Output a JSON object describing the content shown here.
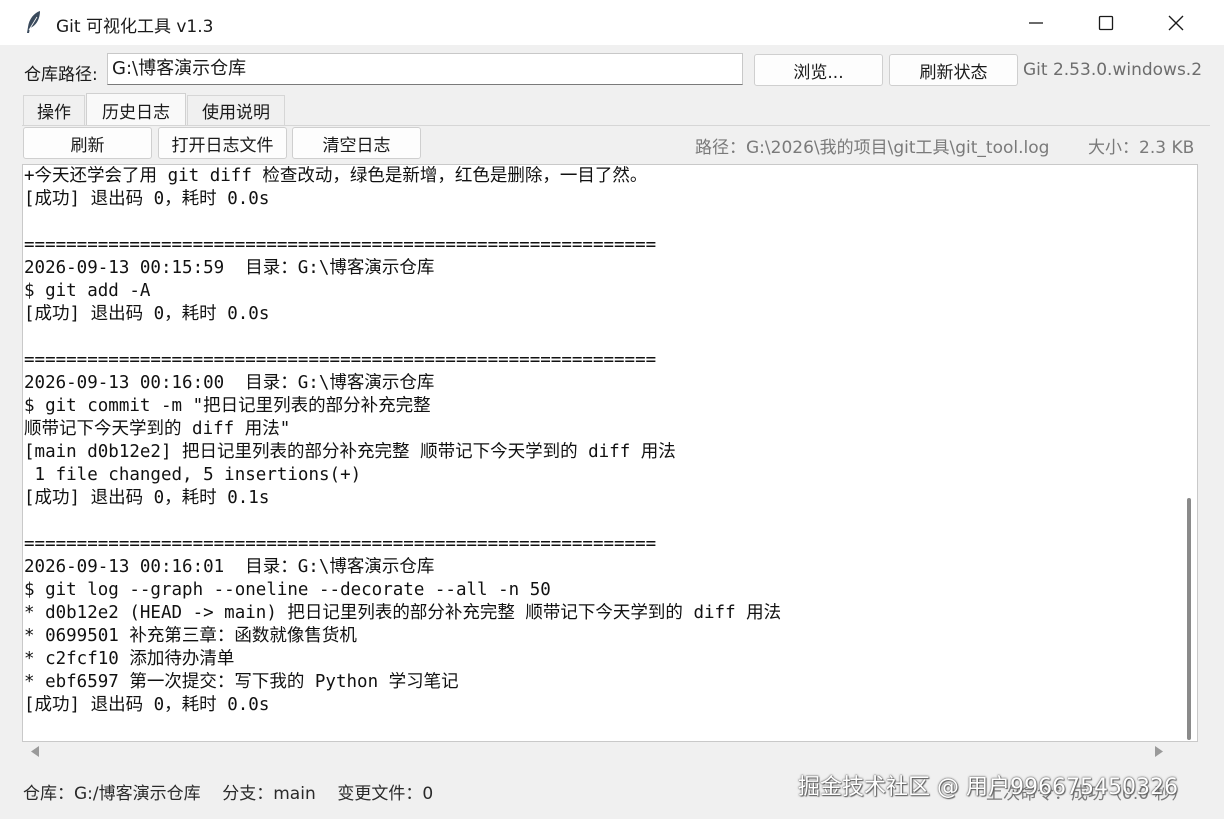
{
  "window": {
    "title": "Git 可视化工具 v1.3",
    "icons": {
      "app": "feather-icon",
      "minimize": "minimize-icon",
      "maximize": "maximize-icon",
      "close": "close-icon"
    }
  },
  "repo_bar": {
    "label": "仓库路径:",
    "path_value": "G:\\博客演示仓库",
    "browse_label": "浏览...",
    "refresh_status_label": "刷新状态",
    "git_version": "Git 2.53.0.windows.2"
  },
  "tabs": [
    {
      "label": "操作",
      "active": false
    },
    {
      "label": "历史日志",
      "active": true
    },
    {
      "label": "使用说明",
      "active": false
    }
  ],
  "log_toolbar": {
    "refresh_label": "刷新",
    "open_log_label": "打开日志文件",
    "clear_log_label": "清空日志",
    "path_text": "路径：G:\\2026\\我的项目\\git工具\\git_tool.log",
    "size_text": "大小：2.3 KB"
  },
  "log_lines": [
    "+今天还学会了用 git diff 检查改动，绿色是新增，红色是删除，一目了然。",
    "[成功] 退出码 0，耗时 0.0s",
    "",
    "============================================================",
    "2026-09-13 00:15:59  目录：G:\\博客演示仓库",
    "$ git add -A",
    "[成功] 退出码 0，耗时 0.0s",
    "",
    "============================================================",
    "2026-09-13 00:16:00  目录：G:\\博客演示仓库",
    "$ git commit -m \"把日记里列表的部分补充完整",
    "顺带记下今天学到的 diff 用法\"",
    "[main d0b12e2] 把日记里列表的部分补充完整 顺带记下今天学到的 diff 用法",
    " 1 file changed, 5 insertions(+)",
    "[成功] 退出码 0，耗时 0.1s",
    "",
    "============================================================",
    "2026-09-13 00:16:01  目录：G:\\博客演示仓库",
    "$ git log --graph --oneline --decorate --all -n 50",
    "* d0b12e2 (HEAD -> main) 把日记里列表的部分补充完整 顺带记下今天学到的 diff 用法",
    "* 0699501 补充第三章：函数就像售货机",
    "* c2fcf10 添加待办清单",
    "* ebf6597 第一次提交：写下我的 Python 学习笔记",
    "[成功] 退出码 0，耗时 0.0s",
    ""
  ],
  "status_bar": {
    "left_text": "仓库：G:/博客演示仓库    分支：main    变更文件：0",
    "right_text": "上次命令：成功（0.0 秒）",
    "watermark": "掘金技术社区 @ 用户996675450326"
  },
  "colors": {
    "background": "#f0f0f0",
    "titlebar": "#ffffff",
    "text": "#1a1a1a",
    "muted": "#7a7a7a"
  }
}
